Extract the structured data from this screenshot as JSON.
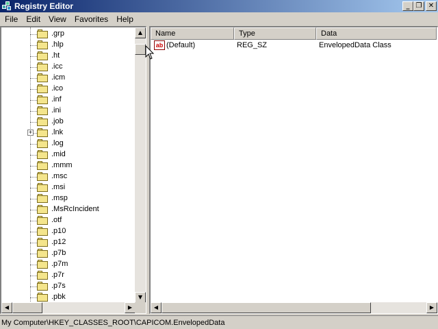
{
  "window": {
    "title": "Registry Editor",
    "buttons": [
      "_",
      "❐",
      "✕"
    ]
  },
  "menu": [
    "File",
    "Edit",
    "View",
    "Favorites",
    "Help"
  ],
  "tree": {
    "items": [
      {
        "label": ".grp"
      },
      {
        "label": ".hlp"
      },
      {
        "label": ".ht"
      },
      {
        "label": ".icc"
      },
      {
        "label": ".icm"
      },
      {
        "label": ".ico"
      },
      {
        "label": ".inf"
      },
      {
        "label": ".ini"
      },
      {
        "label": ".job"
      },
      {
        "label": ".lnk",
        "expander": "+"
      },
      {
        "label": ".log"
      },
      {
        "label": ".mid"
      },
      {
        "label": ".mmm"
      },
      {
        "label": ".msc"
      },
      {
        "label": ".msi"
      },
      {
        "label": ".msp"
      },
      {
        "label": ".MsRcIncident"
      },
      {
        "label": ".otf"
      },
      {
        "label": ".p10"
      },
      {
        "label": ".p12"
      },
      {
        "label": ".p7b"
      },
      {
        "label": ".p7m"
      },
      {
        "label": ".p7r"
      },
      {
        "label": ".p7s"
      },
      {
        "label": ".pbk"
      }
    ]
  },
  "list": {
    "columns": [
      "Name",
      "Type",
      "Data"
    ],
    "rows": [
      {
        "name": "(Default)",
        "type": "REG_SZ",
        "data": "EnvelopedData Class",
        "icon": "ab"
      }
    ]
  },
  "status": {
    "path": "My Computer\\HKEY_CLASSES_ROOT\\CAPICOM.EnvelopedData"
  },
  "scrollbar_glyphs": {
    "up": "▲",
    "down": "▼",
    "left": "◀",
    "right": "▶"
  }
}
